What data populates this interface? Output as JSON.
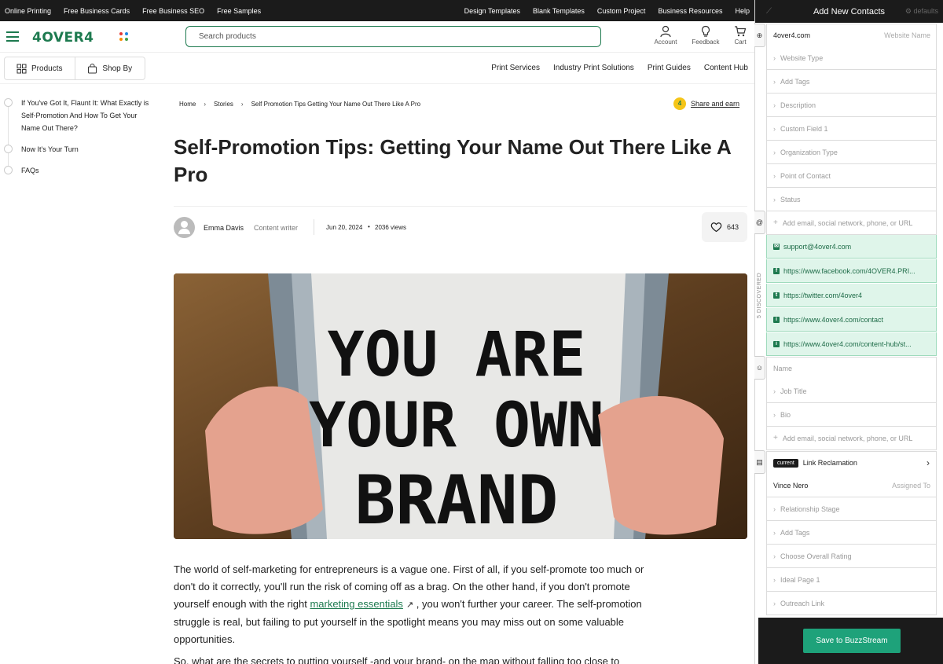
{
  "topbar": {
    "left": [
      "Online Printing",
      "Free Business Cards",
      "Free Business SEO",
      "Free Samples"
    ],
    "right": [
      "Design Templates",
      "Blank Templates",
      "Custom Project",
      "Business Resources",
      "Help"
    ]
  },
  "header": {
    "logo": "4OVER4",
    "search_placeholder": "Search products",
    "account": "Account",
    "feedback": "Feedback",
    "cart": "Cart"
  },
  "subnav": {
    "products": "Products",
    "shop_by": "Shop By",
    "links": [
      "Print Services",
      "Industry Print Solutions",
      "Print Guides",
      "Content Hub"
    ]
  },
  "toc": [
    "If You've Got It, Flaunt It: What Exactly is Self-Promotion And How To Get Your Name Out There?",
    "Now It's Your Turn",
    "FAQs"
  ],
  "breadcrumb": [
    "Home",
    "Stories",
    "Self Promotion Tips Getting Your Name Out There Like A Pro"
  ],
  "share": "Share and earn",
  "article": {
    "title": "Self-Promotion Tips: Getting Your Name Out There Like A Pro",
    "author": "Emma Davis",
    "role": "Content writer",
    "date": "Jun 20, 2024",
    "views": "2036 views",
    "likes": "643",
    "hero_text": [
      "YOU ARE",
      "YOUR OWN",
      "BRAND"
    ],
    "p1_before": "The world of self-marketing for entrepreneurs is a vague one. First of all, if you self-promote too much or don't do it correctly, you'll run the risk of coming off as a brag. On the other hand, if you don't promote yourself enough with the right ",
    "p1_link": "marketing essentials",
    "p1_after": " , you won't further your career. The self-promotion struggle is real, but failing to put yourself in the spotlight means you may miss out on some valuable opportunities.",
    "p2": "So, what are the secrets to putting yourself -and your brand- on the map without falling too close to"
  },
  "panel": {
    "title": "Add New Contacts",
    "defaults": "defaults",
    "website": "4over4.com",
    "website_hint": "Website Name",
    "site_fields": [
      "Website Type",
      "Add Tags",
      "Description",
      "Custom Field 1",
      "Organization Type",
      "Point of Contact",
      "Status"
    ],
    "add_contact_hint": "Add email, social network, phone, or URL",
    "discovered_label": "5 DISCOVERED",
    "discovered": [
      {
        "icon": "email-icon",
        "glyph": "✉",
        "text": "support@4over4.com"
      },
      {
        "icon": "facebook-icon",
        "glyph": "f",
        "text": "https://www.facebook.com/4OVER4.PRI..."
      },
      {
        "icon": "twitter-icon",
        "glyph": "t",
        "text": "https://twitter.com/4over4"
      },
      {
        "icon": "info-icon",
        "glyph": "i",
        "text": "https://www.4over4.com/contact"
      },
      {
        "icon": "info-icon",
        "glyph": "i",
        "text": "https://www.4over4.com/content-hub/st..."
      }
    ],
    "name_hint": "Name",
    "person_fields": [
      "Job Title",
      "Bio"
    ],
    "add_contact_hint2": "Add email, social network, phone, or URL",
    "current_badge": "current",
    "project": "Link Reclamation",
    "assigned_name": "Vince Nero",
    "assigned_hint": "Assigned To",
    "project_fields": [
      "Relationship Stage",
      "Add Tags",
      "Choose Overall Rating",
      "Ideal Page 1",
      "Outreach Link"
    ],
    "save": "Save to BuzzStream"
  },
  "colors": {
    "brand_green": "#1d7a4f",
    "save_green": "#1ea27a",
    "discovered_bg": "#dff5ea"
  }
}
